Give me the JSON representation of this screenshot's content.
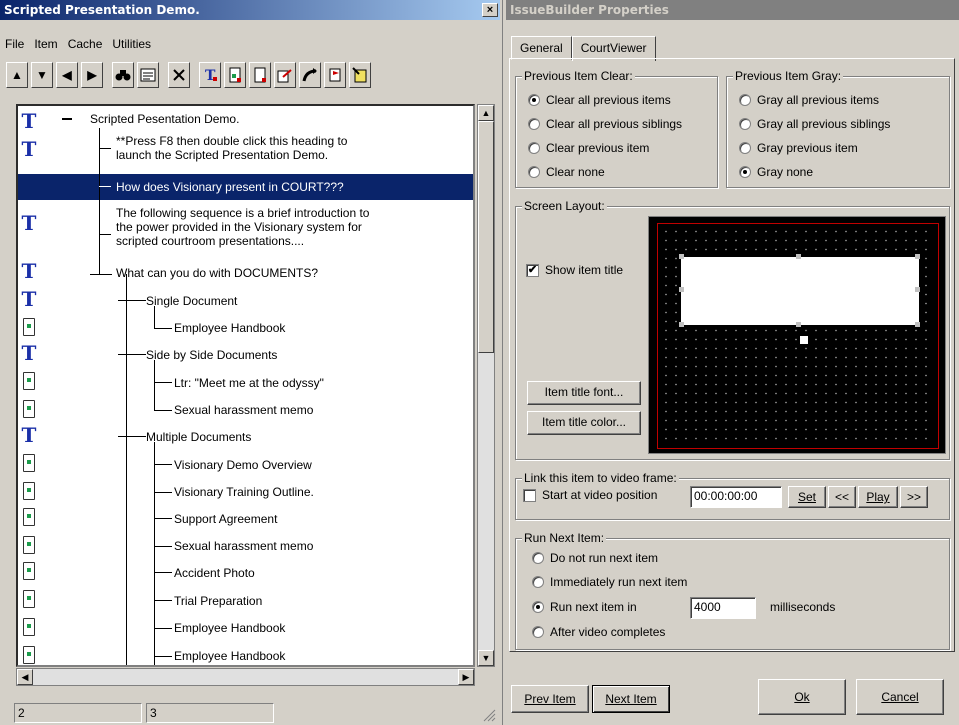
{
  "left_window": {
    "title": "Scripted Presentation Demo.",
    "close": "×",
    "menu": [
      "File",
      "Item",
      "Cache",
      "Utilities"
    ],
    "toolbar_icons": [
      "up-arrow-icon",
      "down-arrow-icon",
      "left-arrow-icon",
      "right-arrow-icon",
      "binoculars-icon",
      "properties-icon",
      "delete-icon",
      "text-item-icon",
      "add-doc-icon",
      "new-doc-icon",
      "import-icon",
      "export-icon",
      "flag-icon",
      "wizard-icon"
    ],
    "tree": {
      "root": "Scripted Pesentation Demo.",
      "n1_line1": "**Press F8 then double click this heading to",
      "n1_line2": "launch the Scripted Presentation Demo.",
      "n2": "How does Visionary present in COURT???",
      "n3_line1": "The following sequence is a brief introduction to",
      "n3_line2": "the power provided in the Visionary system for",
      "n3_line3": "scripted courtroom presentations....",
      "n4": "What can you do with DOCUMENTS?",
      "n5": "Single Document",
      "n6": "Employee Handbook",
      "n7": "Side by Side Documents",
      "n8": "Ltr: \"Meet me at the odyssy\"",
      "n9": "Sexual harassment memo",
      "n10": "Multiple Documents",
      "n11": "Visionary Demo Overview",
      "n12": "Visionary Training Outline.",
      "n13": "Support Agreement",
      "n14": "Sexual harassment memo",
      "n15": "Accident Photo",
      "n16": "Trial Preparation",
      "n17": "Employee Handbook",
      "n18": "Employee Handbook"
    },
    "status": [
      "2",
      "3"
    ]
  },
  "right_window": {
    "title": "IssueBuilder Properties",
    "close": "×",
    "tabs": [
      "General",
      "CourtViewer"
    ],
    "prev_clear": {
      "label": "Previous Item Clear:",
      "options": [
        "Clear all previous items",
        "Clear all previous siblings",
        "Clear previous item",
        "Clear none"
      ]
    },
    "prev_gray": {
      "label": "Previous Item Gray:",
      "options": [
        "Gray all previous items",
        "Gray all previous siblings",
        "Gray previous item",
        "Gray none"
      ]
    },
    "layout": {
      "label": "Screen Layout:",
      "show_title": "Show item title",
      "check": "✔",
      "font_btn": "Item title font...",
      "color_btn": "Item title color..."
    },
    "video": {
      "label": "Link this item to video frame:",
      "start_label": "Start at video position",
      "position": "00:00:00:00",
      "set": "Set",
      "rew": "<<",
      "play": "Play",
      "ff": ">>"
    },
    "run_next": {
      "label": "Run Next Item:",
      "opt1": "Do not run next item",
      "opt2": "Immediately run next item",
      "opt3": "Run next item in",
      "ms_value": "4000",
      "ms_unit": "milliseconds",
      "opt4": "After video completes"
    },
    "prev_item": "Prev Item",
    "next_item": "Next Item",
    "ok": "Ok",
    "cancel": "Cancel"
  }
}
